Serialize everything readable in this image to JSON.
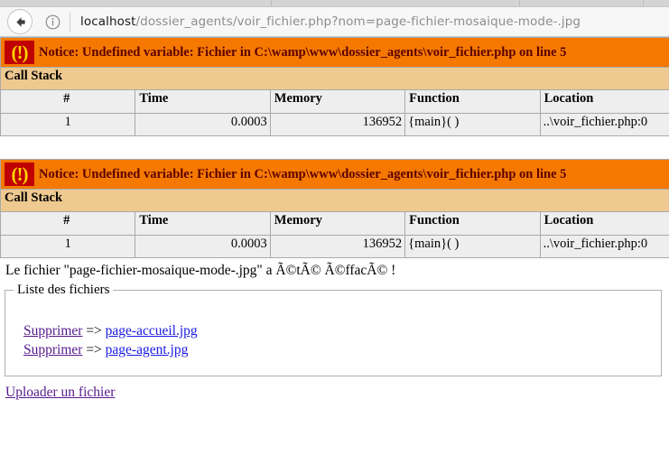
{
  "browser": {
    "back_icon": "back-arrow-icon",
    "site_info_icon": "info-circle-icon",
    "url_host": "localhost",
    "url_path": "/dossier_agents/voir_fichier.php?nom=page-fichier-mosaique-mode-.jpg",
    "url_full": "localhost/dossier_agents/voir_fichier.php?nom=page-fichier-mosaique-mode-.jpg"
  },
  "colors": {
    "notice_bg": "#f57900",
    "notice_text": "#5c0000",
    "icon_bg": "#c00000",
    "icon_fg": "#ffd700",
    "callstack_bg": "#eec990",
    "table_bg": "#eeeeee",
    "link_visited": "#551a8b",
    "link_unvisited": "#1a1ae6"
  },
  "notices": [
    {
      "icon_glyph": "(!)",
      "icon_name": "error-exclamation-icon",
      "message": "Notice: Undefined variable: Fichier in C:\\wamp\\www\\dossier_agents\\voir_fichier.php on line 5",
      "call_stack_label": "Call Stack",
      "columns": [
        "#",
        "Time",
        "Memory",
        "Function",
        "Location"
      ],
      "rows": [
        {
          "num": "1",
          "time": "0.0003",
          "memory": "136952",
          "function": "{main}( )",
          "location": "..\\voir_fichier.php:0"
        }
      ]
    },
    {
      "icon_glyph": "(!)",
      "icon_name": "error-exclamation-icon",
      "message": "Notice: Undefined variable: Fichier in C:\\wamp\\www\\dossier_agents\\voir_fichier.php on line 5",
      "call_stack_label": "Call Stack",
      "columns": [
        "#",
        "Time",
        "Memory",
        "Function",
        "Location"
      ],
      "rows": [
        {
          "num": "1",
          "time": "0.0003",
          "memory": "136952",
          "function": "{main}( )",
          "location": "..\\voir_fichier.php:0"
        }
      ]
    }
  ],
  "result_message": "Le fichier \"page-fichier-mosaique-mode-.jpg\" a Ã©tÃ© Ã©ffacÃ© !",
  "files_panel": {
    "legend": "Liste des fichiers",
    "items": [
      {
        "delete_label": "Supprimer",
        "separator": "=>",
        "filename": "page-accueil.jpg"
      },
      {
        "delete_label": "Supprimer",
        "separator": "=>",
        "filename": "page-agent.jpg"
      }
    ]
  },
  "upload_link": "Uploader un fichier"
}
